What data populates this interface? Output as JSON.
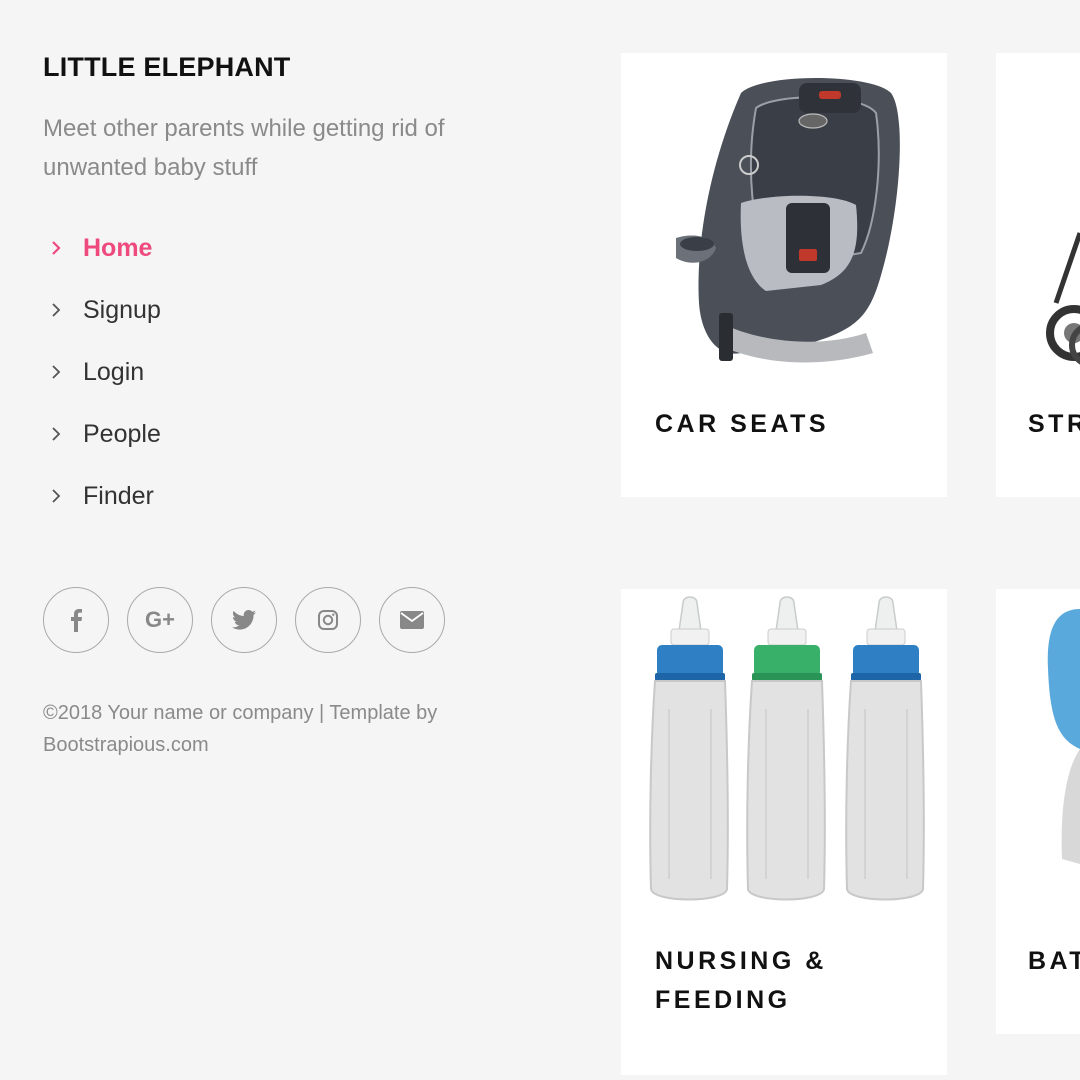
{
  "brand": {
    "name": "LITTLE ELEPHANT",
    "tagline": "Meet other parents while getting rid of unwanted baby stuff"
  },
  "nav": {
    "items": [
      {
        "label": "Home",
        "active": true
      },
      {
        "label": "Signup"
      },
      {
        "label": "Login"
      },
      {
        "label": "People"
      },
      {
        "label": "Finder"
      }
    ]
  },
  "social": {
    "icons": [
      "facebook-icon",
      "google-plus-icon",
      "twitter-icon",
      "instagram-icon",
      "envelope-icon"
    ],
    "gplus_text": "G+"
  },
  "footer": {
    "copyright": "©2018 Your name or company | Template by Bootstrapious.com"
  },
  "cards": [
    {
      "title": "CAR SEATS",
      "image": "car-seat-image"
    },
    {
      "title": "STR",
      "image": "stroller-image"
    },
    {
      "title": "NURSING & FEEDING",
      "image": "baby-bottles-image"
    },
    {
      "title": "BAT",
      "image": "bath-image"
    }
  ],
  "colors": {
    "accent": "#ef4a7d",
    "background": "#f5f5f5",
    "card": "#ffffff",
    "muted_text": "#8a8a8a"
  }
}
